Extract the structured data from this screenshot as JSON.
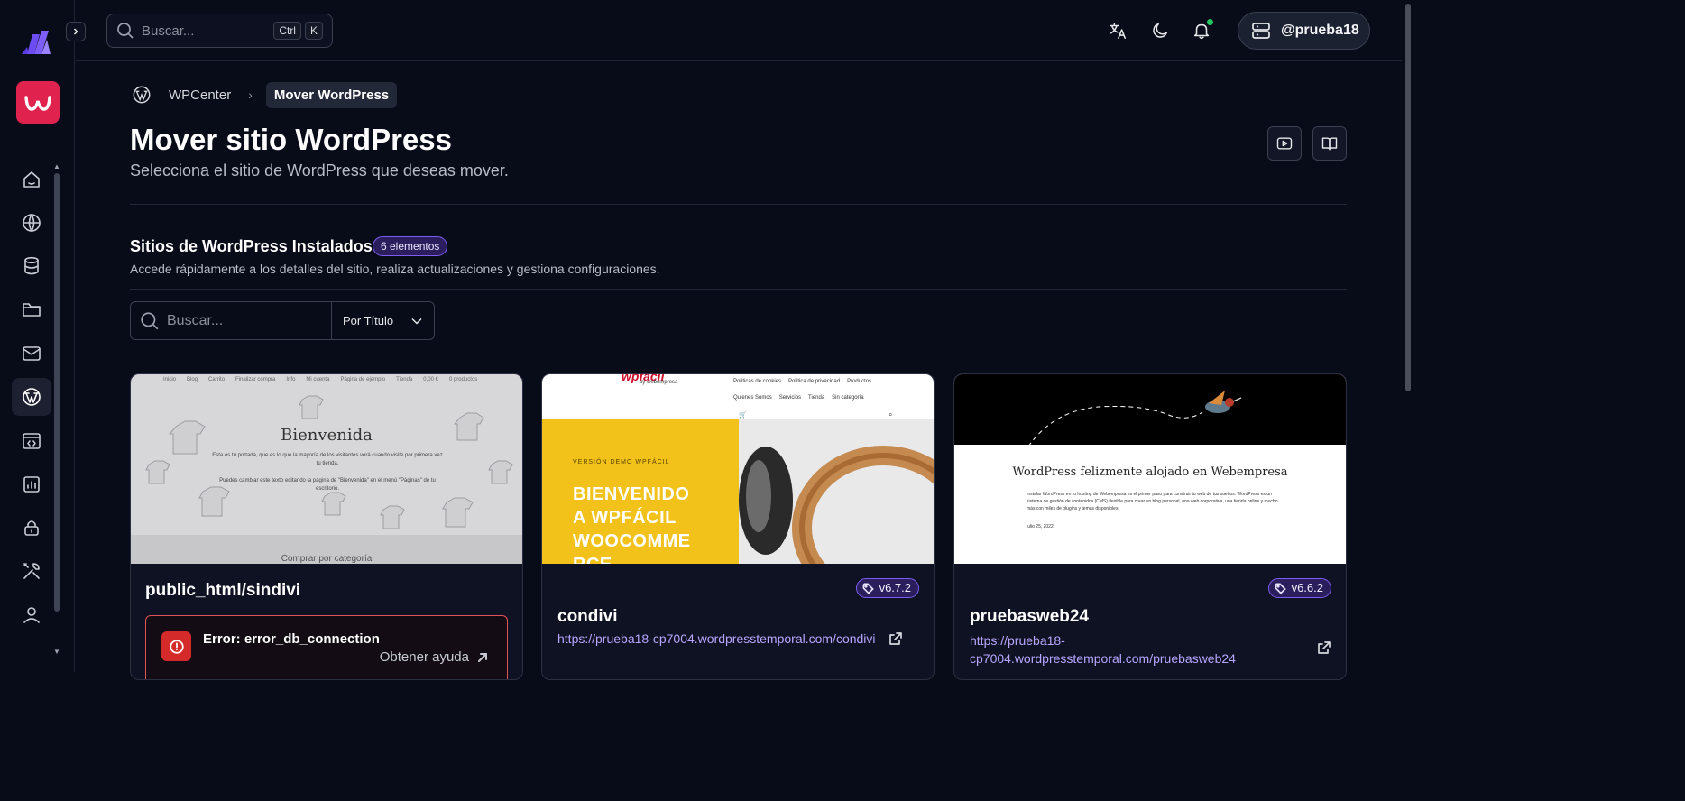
{
  "topbar": {
    "search_placeholder": "Buscar...",
    "shortcut_keys": [
      "Ctrl",
      "K"
    ],
    "username": "@prueba18"
  },
  "breadcrumb": {
    "items": [
      "WPCenter"
    ],
    "current": "Mover WordPress"
  },
  "page": {
    "title": "Mover sitio WordPress",
    "subtitle": "Selecciona el sitio de WordPress que deseas mover."
  },
  "section": {
    "title": "Sitios de WordPress Instalados",
    "count_badge": "6 elementos",
    "description": "Accede rápidamente a los detalles del sitio, realiza actualizaciones y gestiona configuraciones."
  },
  "filter": {
    "search_placeholder": "Buscar...",
    "sort_selected": "Por Título"
  },
  "sites": [
    {
      "name": "public_html/sindivi",
      "error": "Error: error_db_connection",
      "help_label": "Obtener ayuda",
      "thumb": {
        "menu": [
          "Inicio",
          "Blog",
          "Carrito",
          "Finalizar compra",
          "Info",
          "Mi cuenta",
          "Página de ejemplo",
          "Tienda",
          "0,00 €",
          "0 productos"
        ],
        "heading": "Bienvenida",
        "para1": "Esta es tu portada, que es lo que la mayoría de los visitantes verá cuando visite por primera vez tu tienda.",
        "para2": "Puedes cambiar este texto editando la página de \"Bienvenida\" en el menú \"Páginas\" de tu escritorio.",
        "band": "Comprar por categoría"
      }
    },
    {
      "name": "condivi",
      "version": "v6.7.2",
      "url": "https://prueba18-cp7004.wordpresstemporal.com/condivi",
      "thumb": {
        "logo": "wpfácil",
        "logo_sub": "by webempresa",
        "links_row1": [
          "Políticas de cookies",
          "Política de privacidad",
          "Productos"
        ],
        "links_row2": [
          "Quienes Somos",
          "Servicios",
          "Tienda",
          "Sin categoría"
        ],
        "eyebrow": "VERSIÓN DEMO WPFÁCIL",
        "hero": [
          "BIENVENIDO",
          "A WPFÁCIL",
          "WOOCOMME",
          "RCE"
        ]
      }
    },
    {
      "name": "pruebasweb24",
      "version": "v6.6.2",
      "url_line1": "https://prueba18-",
      "url_line2": "cp7004.wordpresstemporal.com/pruebasweb24",
      "thumb": {
        "heading": "WordPress felizmente alojado en Webempresa",
        "para": "Instalar WordPress en tu hosting de Webempresa es el primer paso para construir tu web de tus sueños. WordPress es un sistema de gestión de contenidos (CMS) flexible para crear un blog personal, una web corporativa, una tienda online y mucho más con miles de plugins y temas disponibles.",
        "date": "julio 25, 2022"
      }
    }
  ],
  "colors": {
    "background": "#080b18",
    "brand": "#e0224e",
    "accent": "#7c5cf0",
    "link": "#b7a6ff",
    "error": "#d52a2a",
    "online": "#22c55e"
  },
  "icons": {
    "sidebar": [
      "home-icon",
      "globe-icon",
      "database-icon",
      "folder-icon",
      "mail-icon",
      "wordpress-icon",
      "code-icon",
      "chart-icon",
      "lock-icon",
      "tools-icon",
      "user-icon"
    ],
    "topbar": [
      "search-icon",
      "translate-icon",
      "moon-icon",
      "bell-icon",
      "server-icon"
    ]
  }
}
